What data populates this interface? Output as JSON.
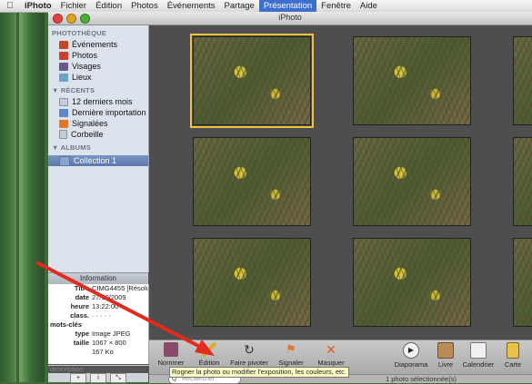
{
  "menubar": {
    "app": "iPhoto",
    "items": [
      "Fichier",
      "Édition",
      "Photos",
      "Événements",
      "Partage",
      "Présentation",
      "Fenêtre",
      "Aide"
    ]
  },
  "window": {
    "title": "iPhoto"
  },
  "source": {
    "library_header": "PHOTOTHÈQUE",
    "library": [
      "Événements",
      "Photos",
      "Visages",
      "Lieux"
    ],
    "recent_header": "▼ RÉCENTS",
    "recent": [
      "12 derniers mois",
      "Dernière importation",
      "Signalées",
      "Corbeille"
    ],
    "albums_header": "▼ ALBUMS",
    "albums": [
      "Collection 1"
    ]
  },
  "info": {
    "header": "Information",
    "title_k": "Titre",
    "title_v": "CIMG4455 [Résolu...",
    "date_k": "date",
    "date_v": "27/10/2009",
    "time_k": "heure",
    "time_v": "13:22:00",
    "class_k": "class.",
    "class_v": "· · · · ·",
    "keywords_k": "mots-clés",
    "type_k": "type",
    "type_v": "Image JPEG",
    "size_k": "taille",
    "size_v": "1067 × 800",
    "weight_v": "167 Ko",
    "description": "description"
  },
  "toolbar": {
    "name": "Nommer",
    "edit": "Édition",
    "rotate": "Faire pivoter",
    "flag": "Signaler",
    "hide": "Masquer",
    "slideshow": "Diaporama",
    "book": "Livre",
    "calendar": "Calendrier",
    "card": "Carte"
  },
  "tooltip": "Rogner la photo ou modifier l'exposition, les couleurs, etc.",
  "search": {
    "placeholder": "Rechercher"
  },
  "status": "1 photo sélectionnée(s)",
  "source_buttons": {
    "add": "+",
    "info": "i",
    "full": "⤡"
  }
}
